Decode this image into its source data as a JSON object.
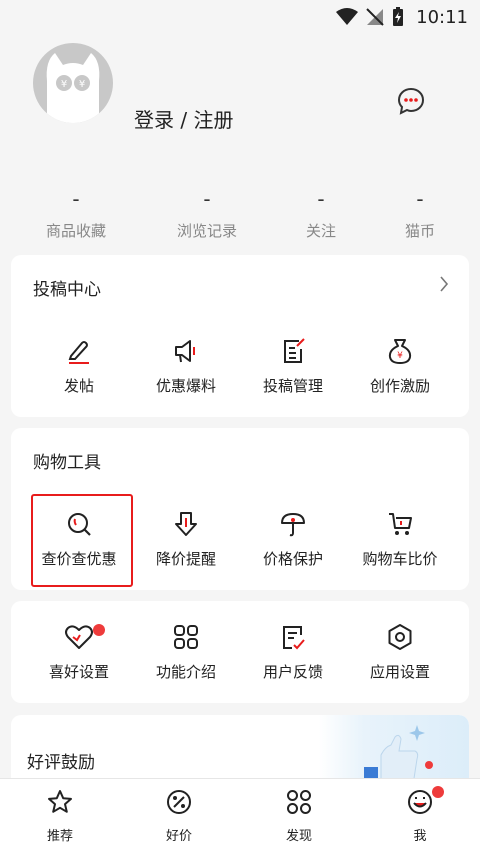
{
  "status_bar": {
    "time": "10:11"
  },
  "profile": {
    "login_label": "登录 / 注册"
  },
  "stats": [
    {
      "value": "-",
      "label": "商品收藏"
    },
    {
      "value": "-",
      "label": "浏览记录"
    },
    {
      "value": "-",
      "label": "关注"
    },
    {
      "value": "-",
      "label": "猫币"
    }
  ],
  "submission_center": {
    "title": "投稿中心",
    "items": [
      {
        "label": "发帖",
        "icon": "edit-pen-icon"
      },
      {
        "label": "优惠爆料",
        "icon": "megaphone-icon"
      },
      {
        "label": "投稿管理",
        "icon": "document-edit-icon"
      },
      {
        "label": "创作激励",
        "icon": "money-bag-icon"
      }
    ]
  },
  "shopping_tools": {
    "title": "购物工具",
    "items": [
      {
        "label": "查价查优惠",
        "icon": "search-icon"
      },
      {
        "label": "降价提醒",
        "icon": "price-drop-icon"
      },
      {
        "label": "价格保护",
        "icon": "umbrella-icon"
      },
      {
        "label": "购物车比价",
        "icon": "cart-icon"
      }
    ]
  },
  "settings": {
    "items": [
      {
        "label": "喜好设置",
        "icon": "heart-icon"
      },
      {
        "label": "功能介绍",
        "icon": "grid-icon"
      },
      {
        "label": "用户反馈",
        "icon": "feedback-icon"
      },
      {
        "label": "应用设置",
        "icon": "settings-icon"
      }
    ]
  },
  "praise": {
    "title": "好评鼓励"
  },
  "bottom_nav": [
    {
      "label": "推荐",
      "icon": "star-icon"
    },
    {
      "label": "好价",
      "icon": "discount-icon"
    },
    {
      "label": "发现",
      "icon": "discover-icon"
    },
    {
      "label": "我",
      "icon": "me-icon"
    }
  ],
  "colors": {
    "accent_red": "#e81c1c",
    "badge_red": "#ee3b3b",
    "background": "#f5f5f5"
  }
}
